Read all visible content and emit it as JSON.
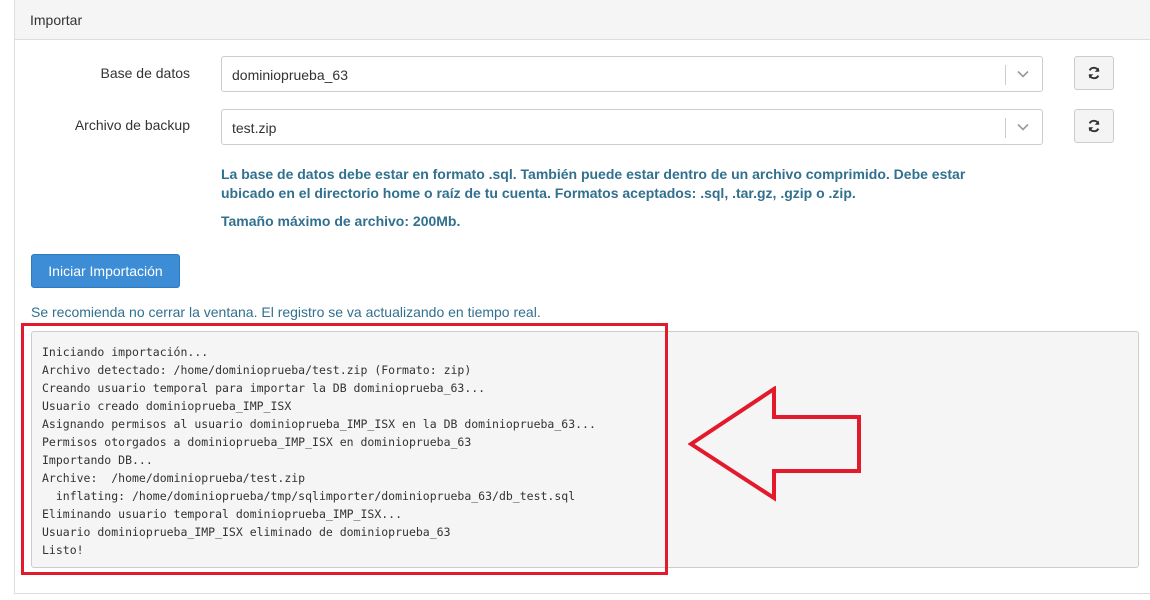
{
  "panel": {
    "title": "Importar"
  },
  "form": {
    "database": {
      "label": "Base de datos",
      "value": "dominioprueba_63"
    },
    "backup": {
      "label": "Archivo de backup",
      "value": "test.zip"
    },
    "help_line1": "La base de datos debe estar en formato .sql. También puede estar dentro de un archivo comprimido. Debe estar",
    "help_line2": "ubicado en el directorio home o raíz de tu cuenta. Formatos aceptados: .sql, .tar.gz, .gzip o .zip.",
    "max_size": "Tamaño máximo de archivo: 200Mb."
  },
  "actions": {
    "start_label": "Iniciar Importación"
  },
  "note": "Se recomienda no cerrar la ventana. El registro se va actualizando en tiempo real.",
  "log": {
    "lines": [
      "Iniciando importación...",
      "Archivo detectado: /home/dominioprueba/test.zip (Formato: zip)",
      "Creando usuario temporal para importar la DB dominioprueba_63...",
      "Usuario creado dominioprueba_IMP_ISX",
      "Asignando permisos al usuario dominioprueba_IMP_ISX en la DB dominioprueba_63...",
      "Permisos otorgados a dominioprueba_IMP_ISX en dominioprueba_63",
      "Importando DB...",
      "Archive:  /home/dominioprueba/test.zip",
      "  inflating: /home/dominioprueba/tmp/sqlimporter/dominioprueba_63/db_test.sql",
      "Eliminando usuario temporal dominioprueba_IMP_ISX...",
      "Usuario dominioprueba_IMP_ISX eliminado de dominioprueba_63",
      "Listo!"
    ]
  },
  "annotation": {
    "color": "#e31a2b"
  },
  "icons": {
    "refresh": "refresh-icon",
    "chevron": "chevron-down-icon"
  },
  "colors": {
    "primary": "#3c8dd6",
    "info_text": "#31708f"
  }
}
